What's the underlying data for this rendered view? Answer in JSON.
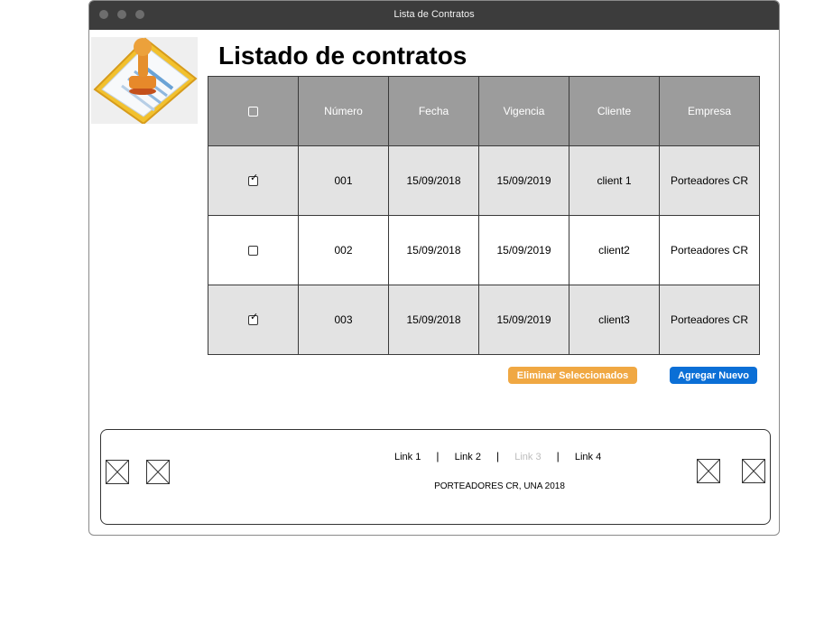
{
  "window": {
    "title": "Lista de Contratos"
  },
  "page": {
    "title": "Listado de contratos"
  },
  "table": {
    "columns": [
      "",
      "Número",
      "Fecha",
      "Vigencia",
      "Cliente",
      "Empresa"
    ],
    "rows": [
      {
        "checked": true,
        "numero": "001",
        "fecha": "15/09/2018",
        "vigencia": "15/09/2019",
        "cliente": "client 1",
        "empresa": "Porteadores CR"
      },
      {
        "checked": false,
        "numero": "002",
        "fecha": "15/09/2018",
        "vigencia": "15/09/2019",
        "cliente": "client2",
        "empresa": "Porteadores CR"
      },
      {
        "checked": true,
        "numero": "003",
        "fecha": "15/09/2018",
        "vigencia": "15/09/2019",
        "cliente": "client3",
        "empresa": "Porteadores CR"
      }
    ]
  },
  "actions": {
    "delete_label": "Eliminar Seleccionados",
    "add_label": "Agregar Nuevo"
  },
  "footer": {
    "links": [
      "Link 1",
      "Link 2",
      "Link 3",
      "Link 4"
    ],
    "separator": "|",
    "copyright": "PORTEADORES CR, UNA 2018"
  },
  "colors": {
    "titlebar": "#3c3c3c",
    "header": "#9c9c9c",
    "delete": "#f0a843",
    "add": "#0b6fd6"
  }
}
